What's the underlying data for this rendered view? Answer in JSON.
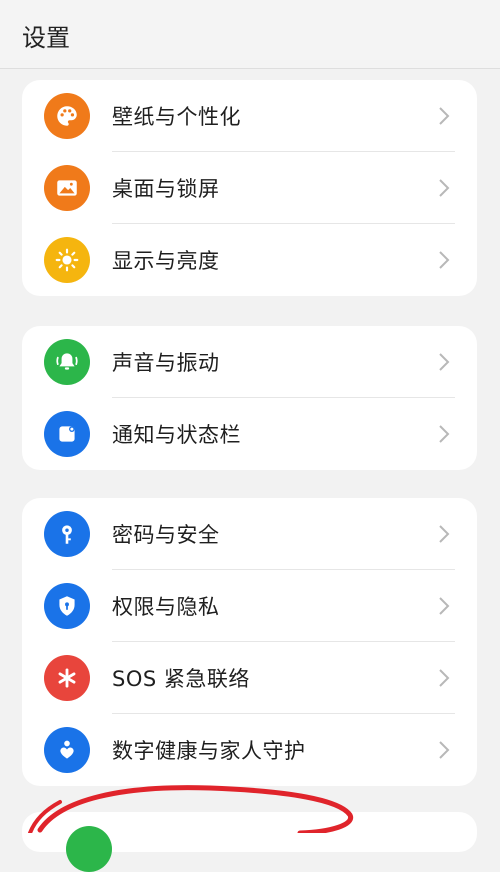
{
  "header": {
    "title": "设置"
  },
  "groups": [
    {
      "items": [
        {
          "label": "壁纸与个性化",
          "icon": "palette-icon",
          "color": "#f07a1a"
        },
        {
          "label": "桌面与锁屏",
          "icon": "image-icon",
          "color": "#f07a1a"
        },
        {
          "label": "显示与亮度",
          "icon": "sun-icon",
          "color": "#f5b50f"
        }
      ]
    },
    {
      "items": [
        {
          "label": "声音与振动",
          "icon": "bell-icon",
          "color": "#2cb64a"
        },
        {
          "label": "通知与状态栏",
          "icon": "notification-icon",
          "color": "#1a73e8"
        }
      ]
    },
    {
      "items": [
        {
          "label": "密码与安全",
          "icon": "key-icon",
          "color": "#1a73e8"
        },
        {
          "label": "权限与隐私",
          "icon": "shield-icon",
          "color": "#1a73e8"
        },
        {
          "label": "SOS 紧急联络",
          "icon": "asterisk-icon",
          "color": "#e8453c"
        },
        {
          "label": "数字健康与家人守护",
          "icon": "family-heart-icon",
          "color": "#1a73e8"
        }
      ]
    }
  ],
  "colors": {
    "background": "#f2f2f2",
    "card": "#ffffff",
    "chevron": "#b8b8b8",
    "annotation": "#e0242b"
  }
}
